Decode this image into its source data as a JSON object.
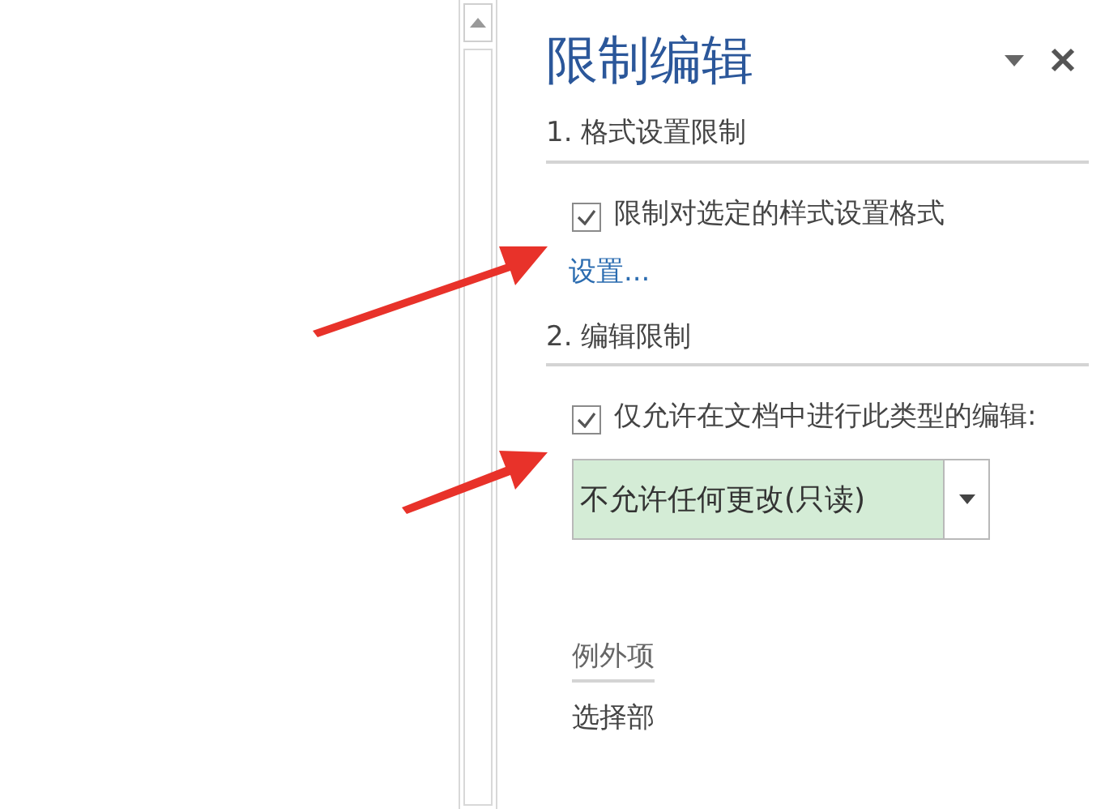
{
  "pane": {
    "title": "限制编辑"
  },
  "sections": [
    {
      "heading": "1. 格式设置限制",
      "option": {
        "label": "限制对选定的样式设置格式",
        "checked": true
      },
      "link": "设置..."
    },
    {
      "heading": "2. 编辑限制",
      "option": {
        "label": "仅允许在文档中进行此类型的编辑:",
        "checked": true
      },
      "select": {
        "value": "不允许任何更改(只读)"
      }
    }
  ],
  "exceptions": {
    "heading": "例外项",
    "text": "选择部"
  }
}
